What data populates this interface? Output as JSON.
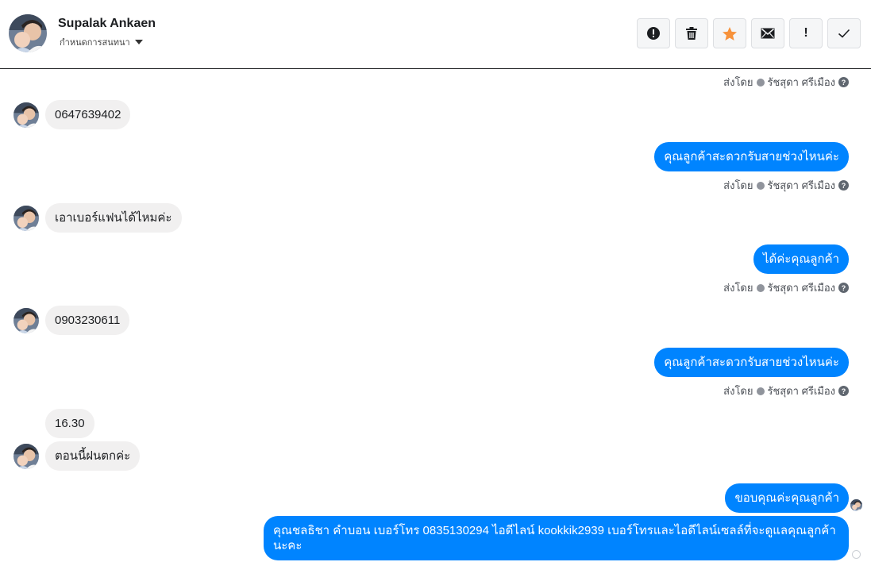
{
  "header": {
    "name": "Supalak Ankaen",
    "status": "กำหนดการสนทนา",
    "actions": [
      {
        "icon": "alert-circle-icon"
      },
      {
        "icon": "trash-icon"
      },
      {
        "icon": "star-icon"
      },
      {
        "icon": "envelope-icon"
      },
      {
        "icon": "exclamation-icon",
        "label": "!"
      },
      {
        "icon": "check-icon"
      }
    ]
  },
  "colors": {
    "sent_bubble": "#0084ff",
    "received_bubble": "#f1f0f0",
    "star": "#f7923b"
  },
  "sent_by": {
    "prefix": "ส่งโดย",
    "agent": "รัชสุดา ศรีเมือง",
    "help": "?"
  },
  "messages": [
    {
      "from": "customer",
      "text": "0647639402"
    },
    {
      "from": "page",
      "text": "คุณลูกค้าสะดวกรับสายช่วงไหนค่ะ"
    },
    {
      "from": "customer",
      "text": "เอาเบอร์แฟนได้ไหมค่ะ"
    },
    {
      "from": "page",
      "text": "ได้ค่ะคุณลูกค้า"
    },
    {
      "from": "customer",
      "text": "0903230611"
    },
    {
      "from": "page",
      "text": "คุณลูกค้าสะดวกรับสายช่วงไหนค่ะ"
    },
    {
      "from": "customer",
      "text": "16.30"
    },
    {
      "from": "customer",
      "text": "ตอนนี้ฝนตกค่ะ"
    },
    {
      "from": "page",
      "text": "ขอบคุณค่ะคุณลูกค้า"
    },
    {
      "from": "page",
      "text": "คุณชลธิชา คำบอน เบอร์โทร 0835130294 ไอดีไลน์ kookkik2939 เบอร์โทรและไอดีไลน์เซลล์ที่จะดูแลคุณลูกค้านะคะ"
    }
  ]
}
